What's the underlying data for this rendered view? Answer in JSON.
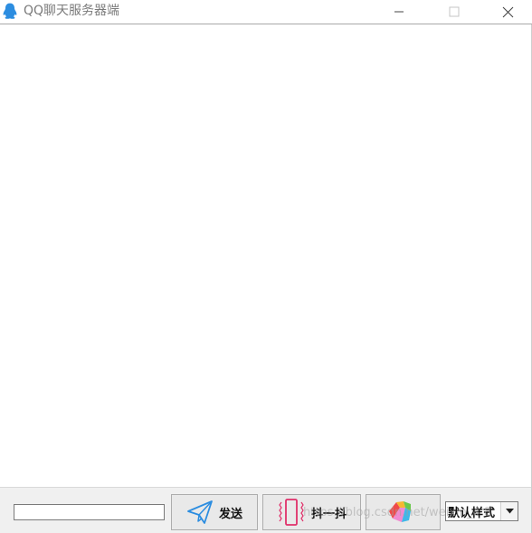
{
  "window": {
    "title": "QQ聊天服务器端",
    "icon": "qq-penguin-icon",
    "controls": [
      "minimize-icon",
      "maximize-icon",
      "close-icon"
    ]
  },
  "message_area": {
    "messages": []
  },
  "toolbar": {
    "input_value": "",
    "send_label": "发送",
    "send_icon": "paper-plane-icon",
    "shake_label": "抖一抖",
    "shake_icon": "vibrate-phone-icon",
    "color_label": "",
    "color_icon": "color-palette-icon",
    "style_selected": "默认样式"
  },
  "watermark": "https://blog.csdn.net/weixin_4 8",
  "colors": {
    "accent_blue": "#2c8de0",
    "shake_pink": "#e0306a",
    "toolbar_bg": "#f0f0f0"
  }
}
